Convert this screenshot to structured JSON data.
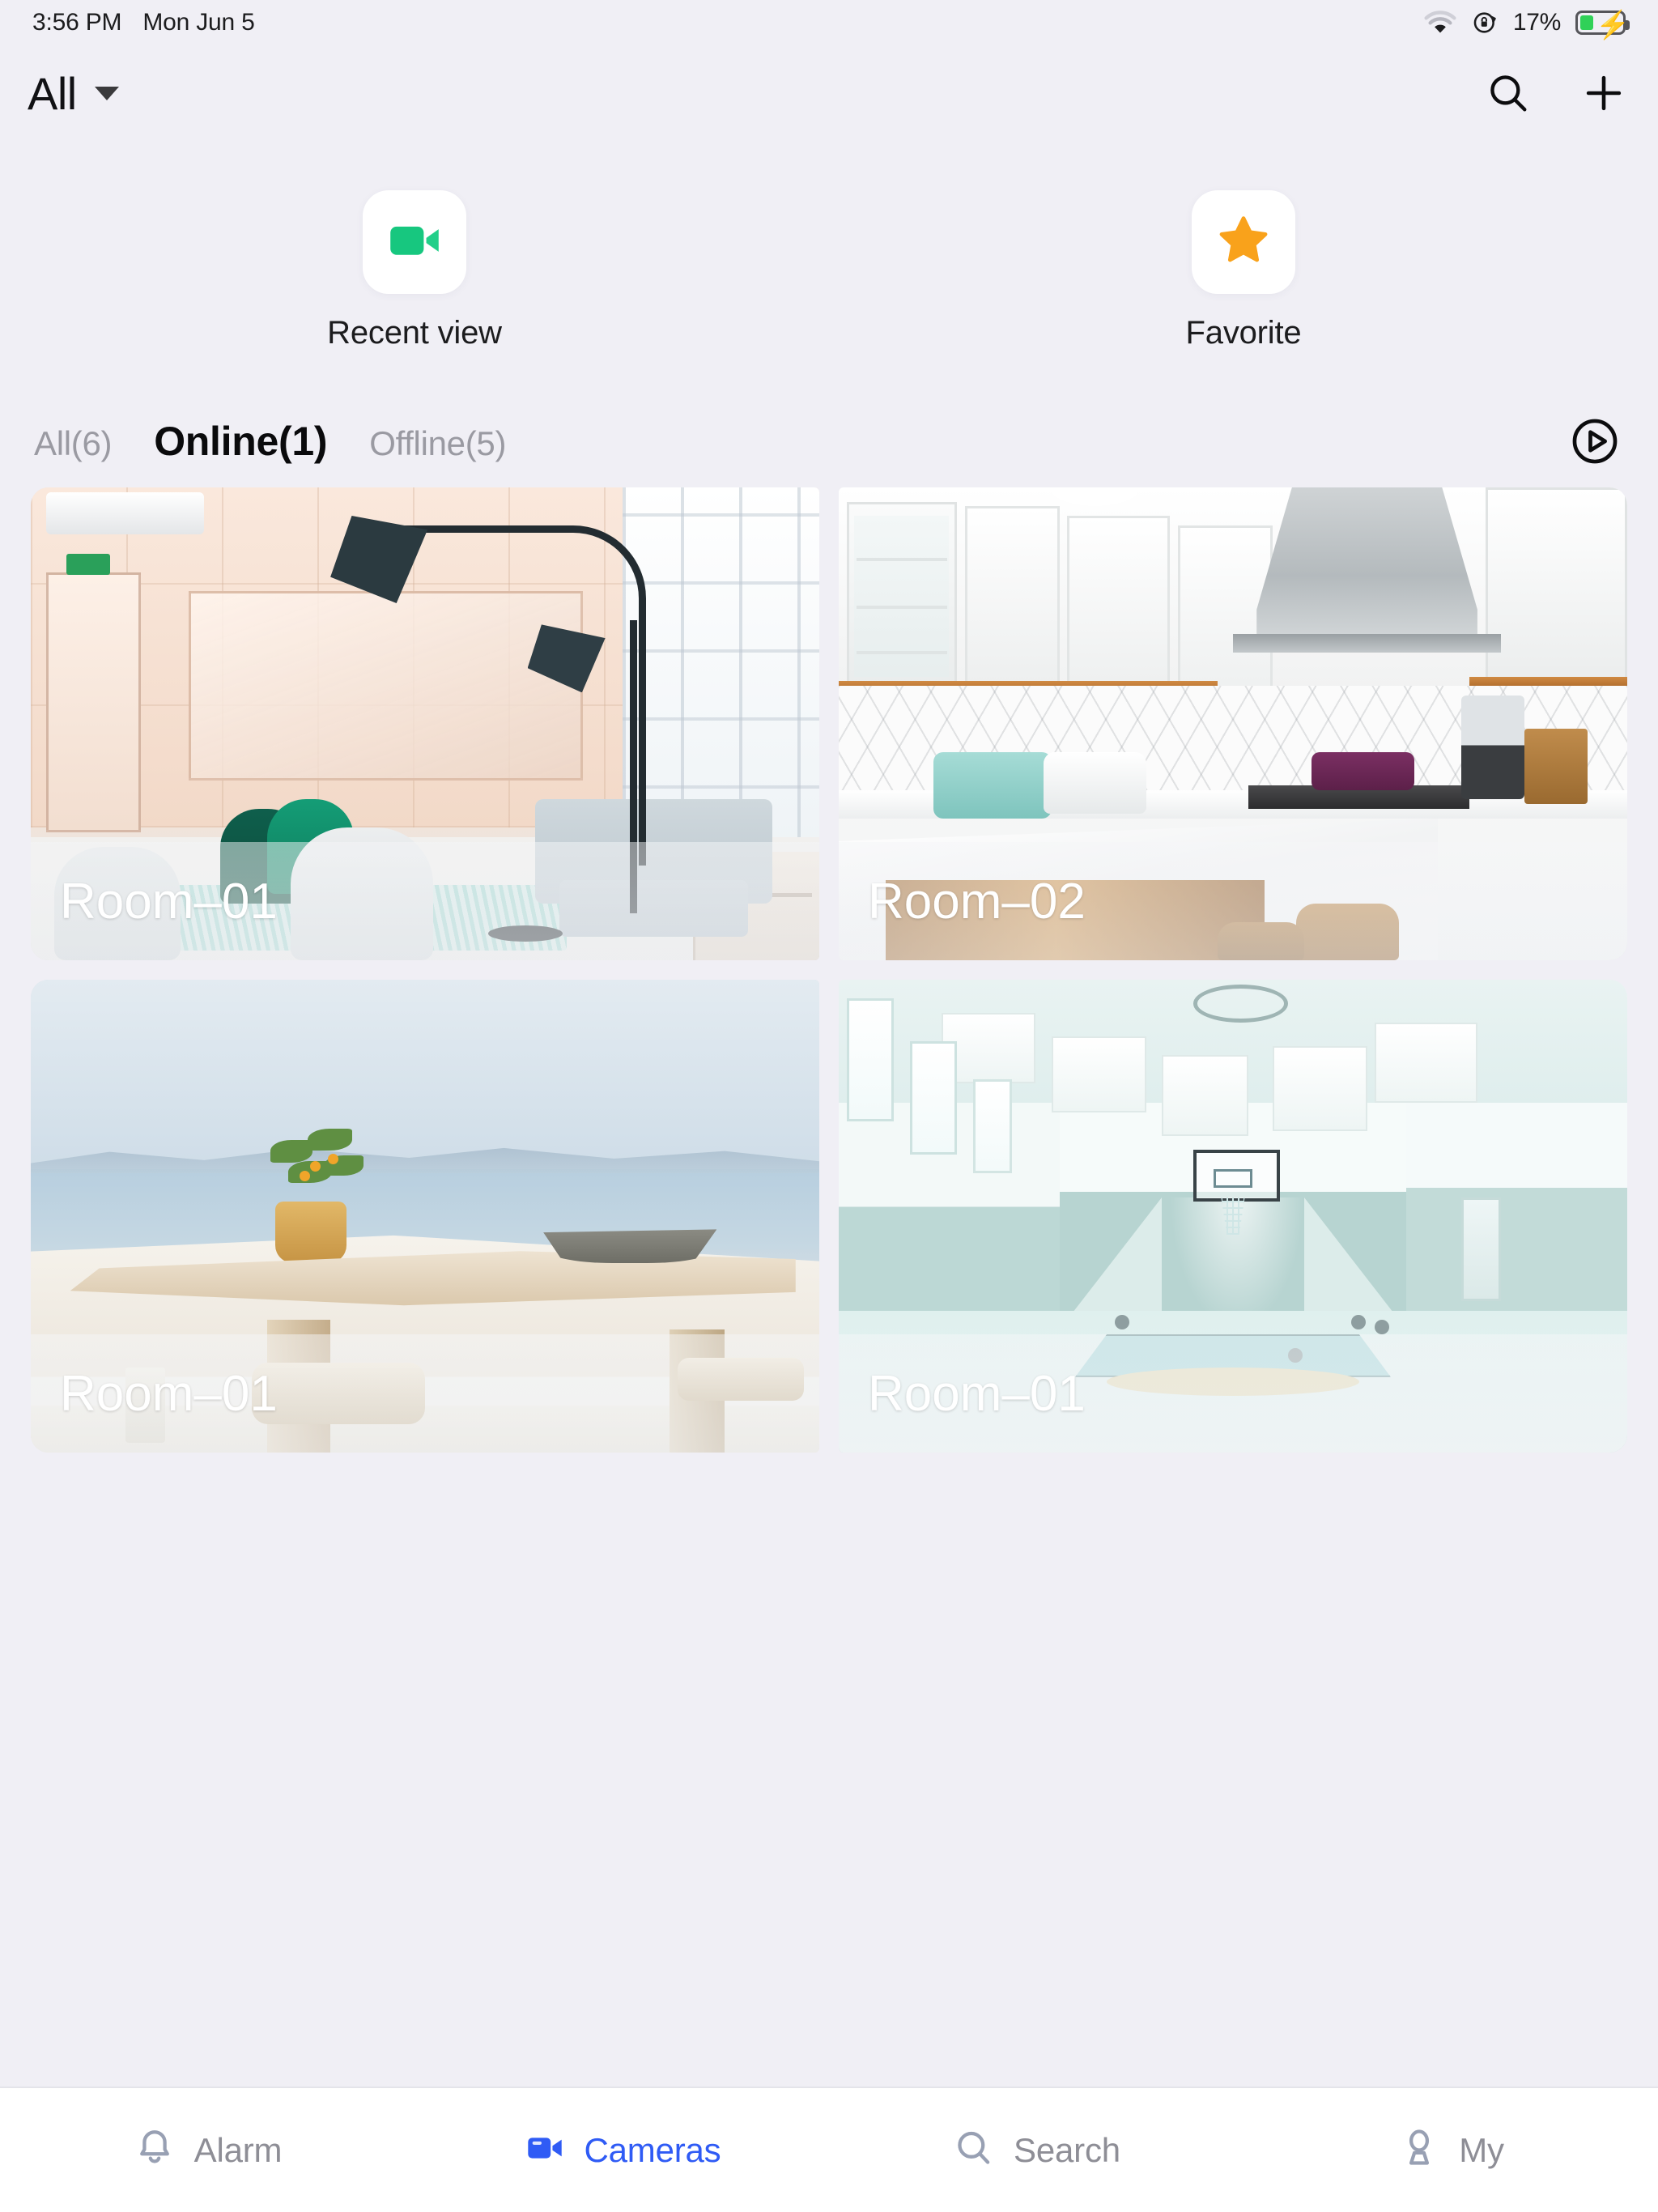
{
  "status_bar": {
    "time": "3:56 PM",
    "date": "Mon Jun 5",
    "wifi_icon": "wifi-icon",
    "rotation_lock_icon": "rotation-lock-icon",
    "battery_percent": "17%",
    "battery_icon": "battery-charging-icon"
  },
  "nav": {
    "title": "All",
    "dropdown_icon": "chevron-down-icon",
    "search_icon": "search-icon",
    "add_icon": "plus-icon"
  },
  "shortcuts": [
    {
      "label": "Recent view",
      "icon": "video-camera-icon",
      "color": "#17c77f"
    },
    {
      "label": "Favorite",
      "icon": "star-icon",
      "color": "#f9a21b"
    }
  ],
  "filters": {
    "tabs": [
      {
        "label": "All(6)",
        "active": false
      },
      {
        "label": "Online(1)",
        "active": true
      },
      {
        "label": "Offline(5)",
        "active": false
      }
    ],
    "play_all_icon": "play-circle-icon"
  },
  "cameras": [
    {
      "name": "Room–01",
      "scene": "living-room"
    },
    {
      "name": "Room–02",
      "scene": "kitchen"
    },
    {
      "name": "Room–01",
      "scene": "terrace"
    },
    {
      "name": "Room–01",
      "scene": "gym"
    }
  ],
  "tab_bar": [
    {
      "label": "Alarm",
      "icon": "bell-icon",
      "active": false
    },
    {
      "label": "Cameras",
      "icon": "video-camera-icon",
      "active": true
    },
    {
      "label": "Search",
      "icon": "search-icon",
      "active": false
    },
    {
      "label": "My",
      "icon": "person-icon",
      "active": false
    }
  ],
  "colors": {
    "background": "#f0eff5",
    "accent": "#2f5bf5",
    "inactive": "#8e8e96",
    "battery_green": "#30d158"
  }
}
